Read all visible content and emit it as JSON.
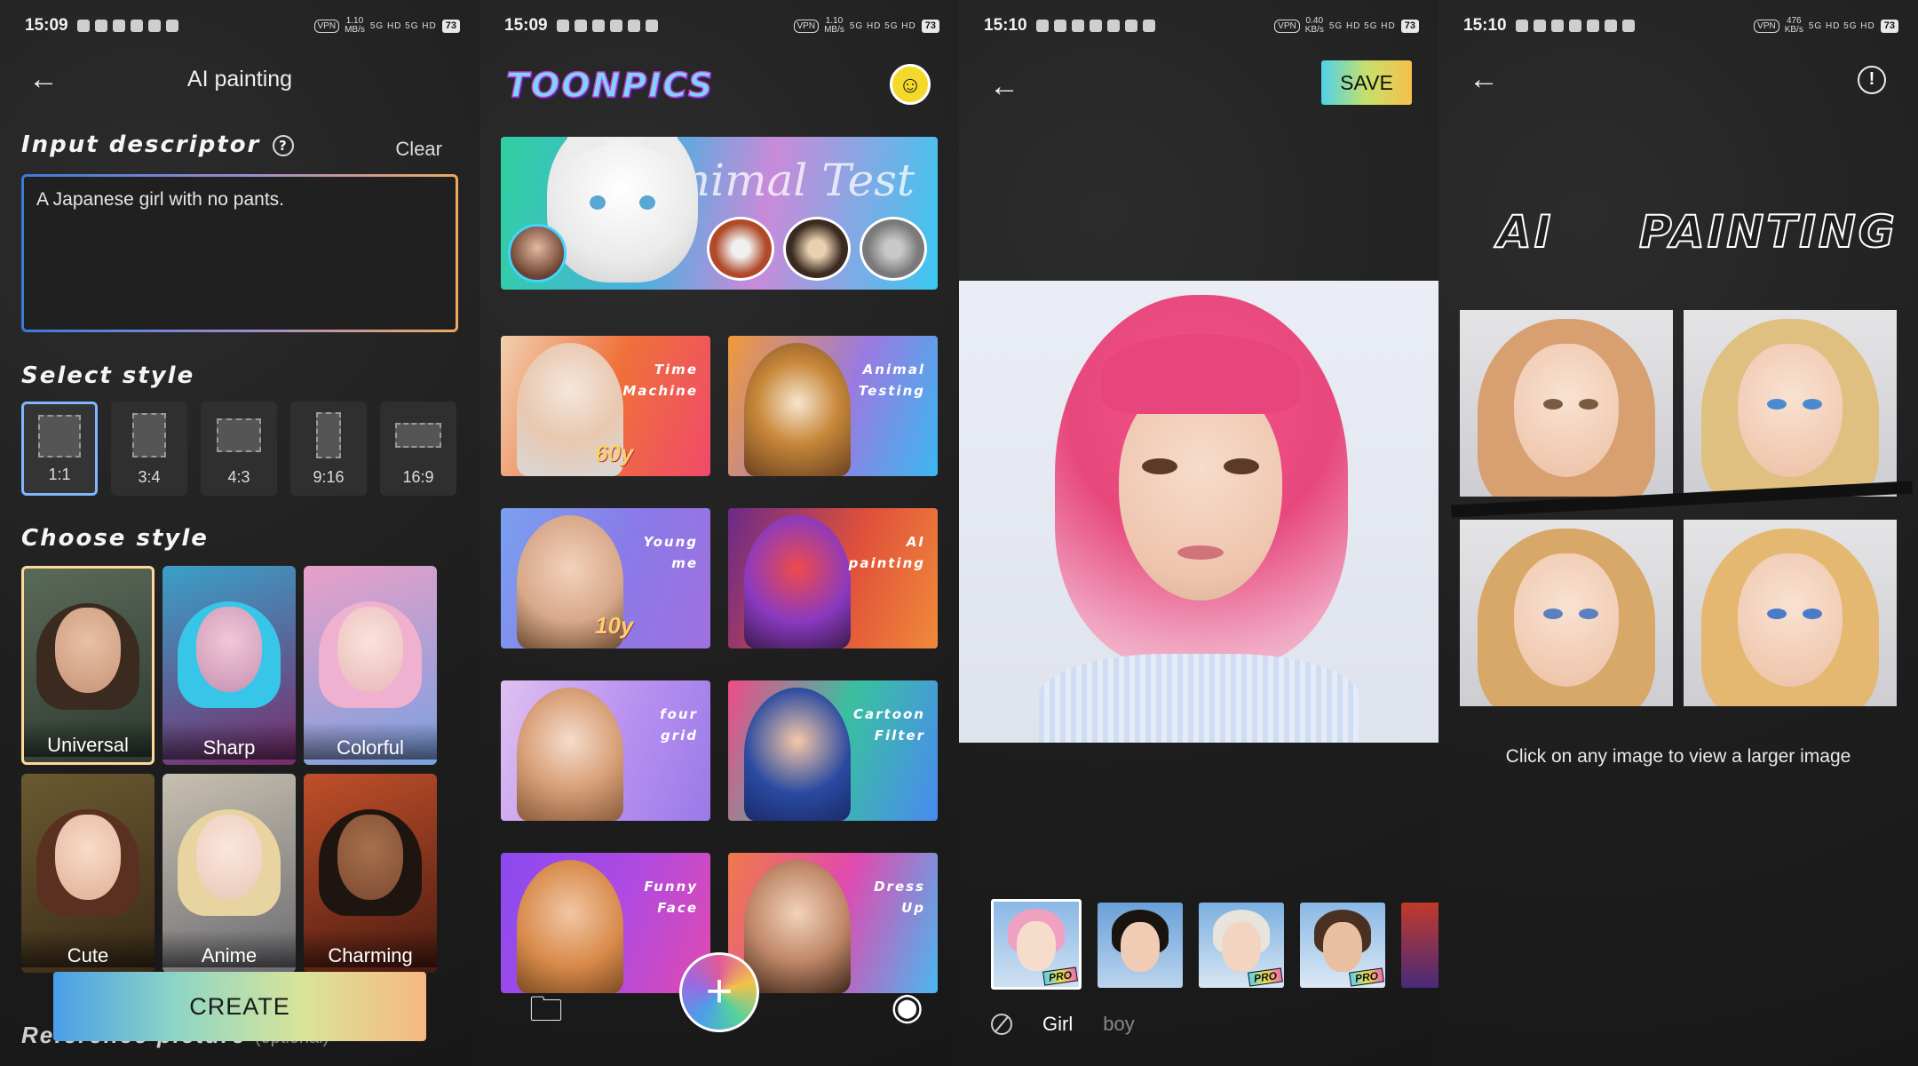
{
  "status_bars": [
    {
      "time": "15:09",
      "vpn": "VPN",
      "net_rate": "1.10",
      "net_unit": "MB/s",
      "signal": "5G HD 5G HD",
      "battery": "73"
    },
    {
      "time": "15:09",
      "vpn": "VPN",
      "net_rate": "1.10",
      "net_unit": "MB/s",
      "signal": "5G HD 5G HD",
      "battery": "73"
    },
    {
      "time": "15:10",
      "vpn": "VPN",
      "net_rate": "0.40",
      "net_unit": "KB/s",
      "signal": "5G HD 5G HD",
      "battery": "73"
    },
    {
      "time": "15:10",
      "vpn": "VPN",
      "net_rate": "476",
      "net_unit": "KB/s",
      "signal": "5G HD 5G HD",
      "battery": "73"
    }
  ],
  "painting_form": {
    "title": "AI painting",
    "descriptor_heading": "Input descriptor",
    "help_glyph": "?",
    "clear_label": "Clear",
    "descriptor_value": "A Japanese girl with no pants.",
    "select_style_heading": "Select style",
    "ratios": [
      "1:1",
      "3:4",
      "4:3",
      "9:16",
      "16:9"
    ],
    "selected_ratio": "1:1",
    "choose_style_heading": "Choose style",
    "styles": [
      "Universal",
      "Sharp",
      "Colorful",
      "Cute",
      "Anime",
      "Charming"
    ],
    "selected_style": "Universal",
    "create_label": "CREATE",
    "reference_heading": "Reference picture",
    "reference_optional": "(optional)"
  },
  "home": {
    "logo_text": "TOONPICS",
    "banner_text": "Animal Test",
    "cards": [
      {
        "title": "Time\nMachine",
        "badge": "60y"
      },
      {
        "title": "Animal\nTesting",
        "badge": ""
      },
      {
        "title": "Young\nme",
        "badge": "10y"
      },
      {
        "title": "AI\npainting",
        "badge": ""
      },
      {
        "title": "four\ngrid",
        "badge": ""
      },
      {
        "title": "Cartoon\nFilter",
        "badge": ""
      },
      {
        "title": "Funny\nFace",
        "badge": ""
      },
      {
        "title": "Dress\nUp",
        "badge": ""
      }
    ],
    "fab_glyph": "+"
  },
  "editor": {
    "save_label": "SAVE",
    "pro_label": "PRO",
    "gender_tabs": [
      "Girl",
      "boy"
    ],
    "selected_gender": "Girl"
  },
  "results": {
    "title_left": "AI",
    "title_right": "PAINTING",
    "info_glyph": "!",
    "hint": "Click on any image to view a larger image"
  },
  "icons": {
    "back": "back-arrow-icon",
    "help": "help-circle-icon",
    "smiley": "smiley-icon",
    "folder": "folder-icon",
    "add": "plus-icon",
    "eye": "eye-icon",
    "none": "no-symbol-icon",
    "info": "info-icon"
  },
  "colors": {
    "background": "#1e1e1e",
    "selection_blue": "#7fb6ff",
    "selection_gold": "#ffd89a",
    "gradient_start": "#4a9ee8",
    "gradient_end": "#f6b880",
    "pink_hair": "#e7487c"
  }
}
